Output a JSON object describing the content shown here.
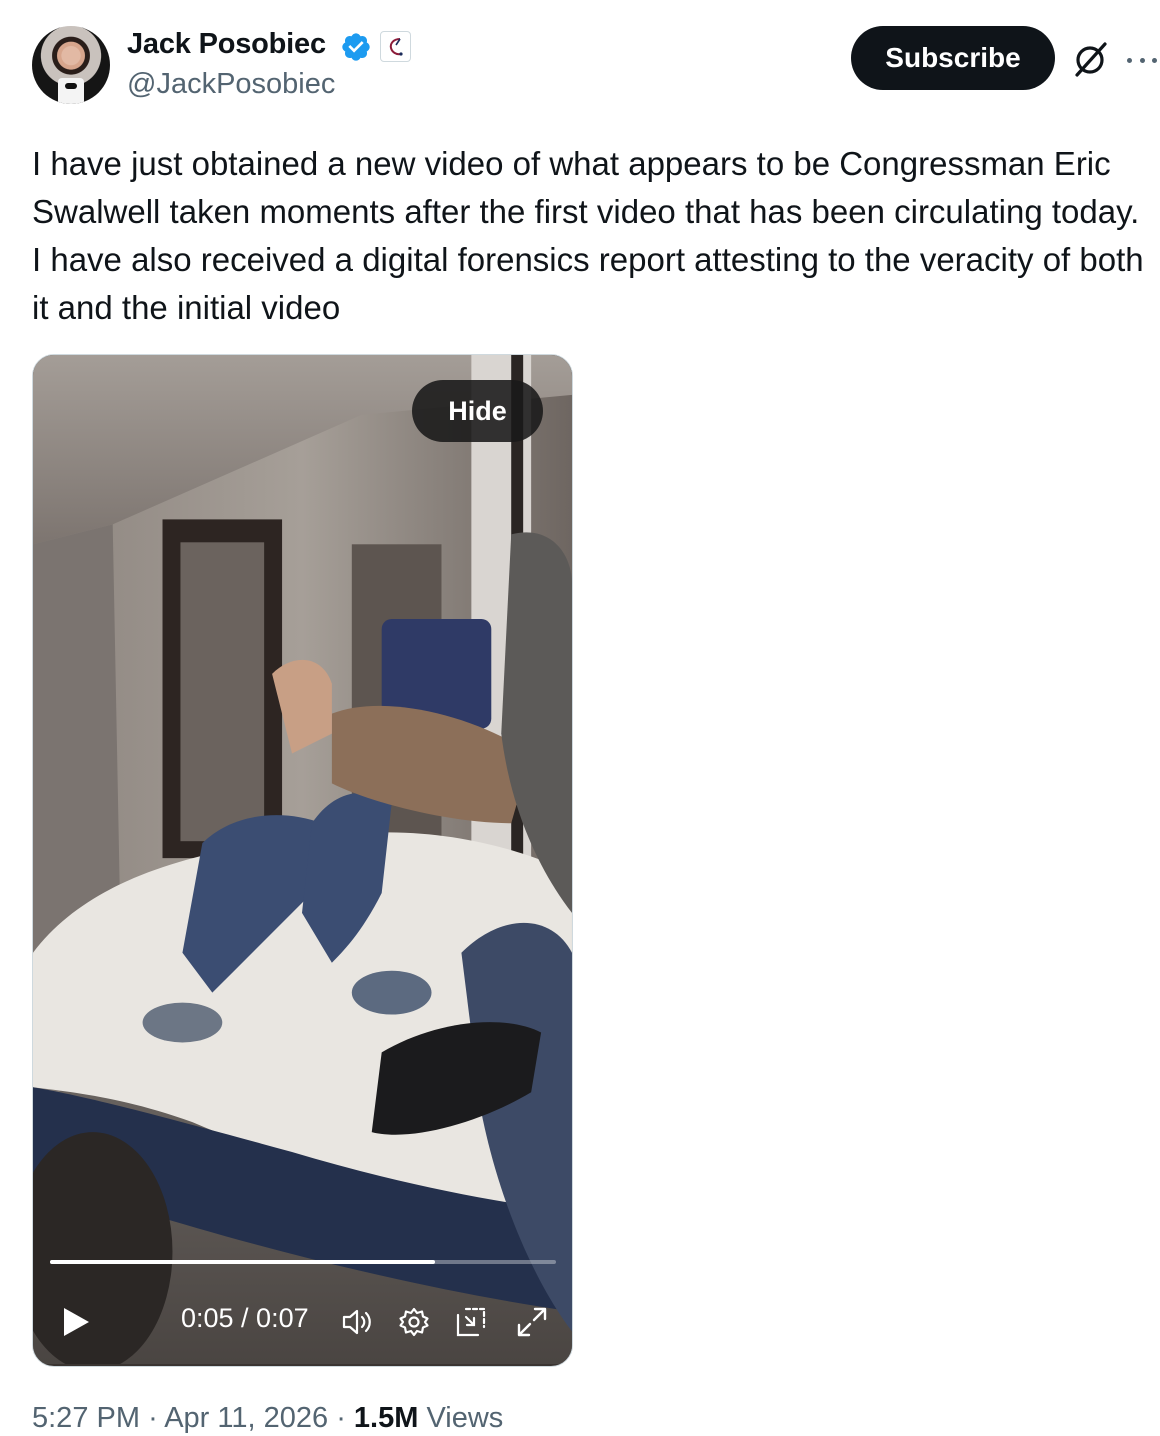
{
  "author": {
    "name": "Jack Posobiec",
    "handle": "@JackPosobiec",
    "verified_color": "#1d9bf0"
  },
  "actions": {
    "subscribe_label": "Subscribe",
    "grok_icon": "grok-icon",
    "more_icon": "more-icon"
  },
  "tweet": {
    "text": "I have just obtained a new video of what appears to be Congressman Eric Swalwell taken moments after the first video that has been circulating today. I have also received a digital forensics report attesting to the veracity of both it and the initial video"
  },
  "video": {
    "hide_label": "Hide",
    "time_display": "0:05 / 0:07",
    "progress": 0.76,
    "controls": [
      "play-icon",
      "volume-icon",
      "settings-icon",
      "pip-icon",
      "fullscreen-icon"
    ]
  },
  "meta": {
    "time": "5:27 PM",
    "separator": "·",
    "date": "Apr 11, 2026",
    "views_count": "1.5M",
    "views_label": "Views"
  }
}
